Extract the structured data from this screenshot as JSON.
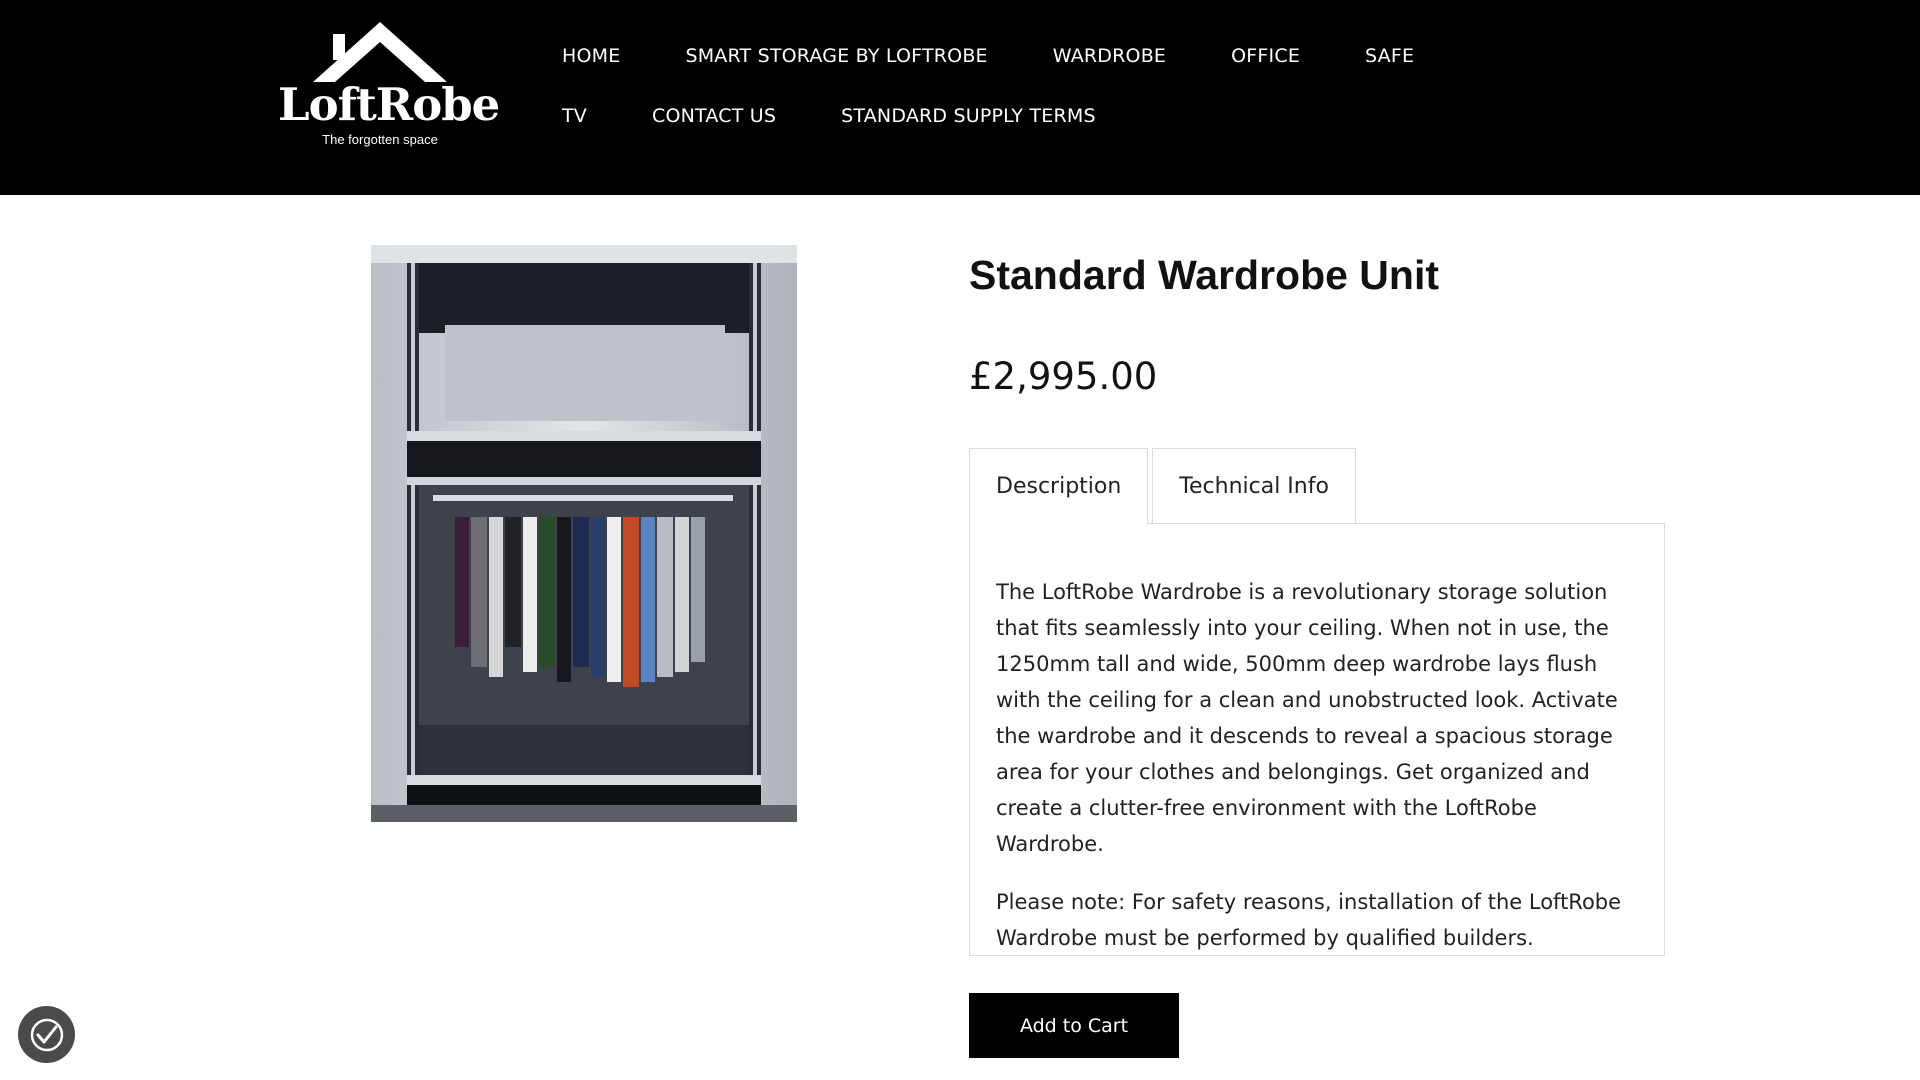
{
  "brand": {
    "name": "LoftRobe",
    "tagline": "The forgotten space"
  },
  "nav": {
    "row1": [
      "HOME",
      "SMART STORAGE BY LOFTROBE",
      "WARDROBE",
      "OFFICE",
      "SAFE"
    ],
    "row2": [
      "TV",
      "CONTACT US",
      "STANDARD SUPPLY TERMS"
    ]
  },
  "product": {
    "title": "Standard Wardrobe Unit",
    "price": "£2,995.00",
    "tabs": [
      "Description",
      "Technical Info"
    ],
    "active_tab": "Description",
    "description": [
      "The LoftRobe Wardrobe is a revolutionary storage solution that fits seamlessly into your ceiling. When not in use, the 1250mm tall and wide, 500mm deep wardrobe lays flush with the ceiling for a clean and unobstructed look. Activate the wardrobe and it descends to reveal a spacious storage area for your clothes and belongings. Get organized and create a clutter-free environment with the LoftRobe Wardrobe.",
      "Please note: For safety reasons, installation of the LoftRobe Wardrobe must be performed by qualified builders."
    ],
    "add_to_cart_label": "Add to Cart"
  },
  "icons": {
    "accessibility": "accessibility-icon",
    "logo_roof": "house-roof-icon"
  },
  "colors": {
    "header_bg": "#000000",
    "button_bg": "#000000",
    "text": "#111111"
  }
}
